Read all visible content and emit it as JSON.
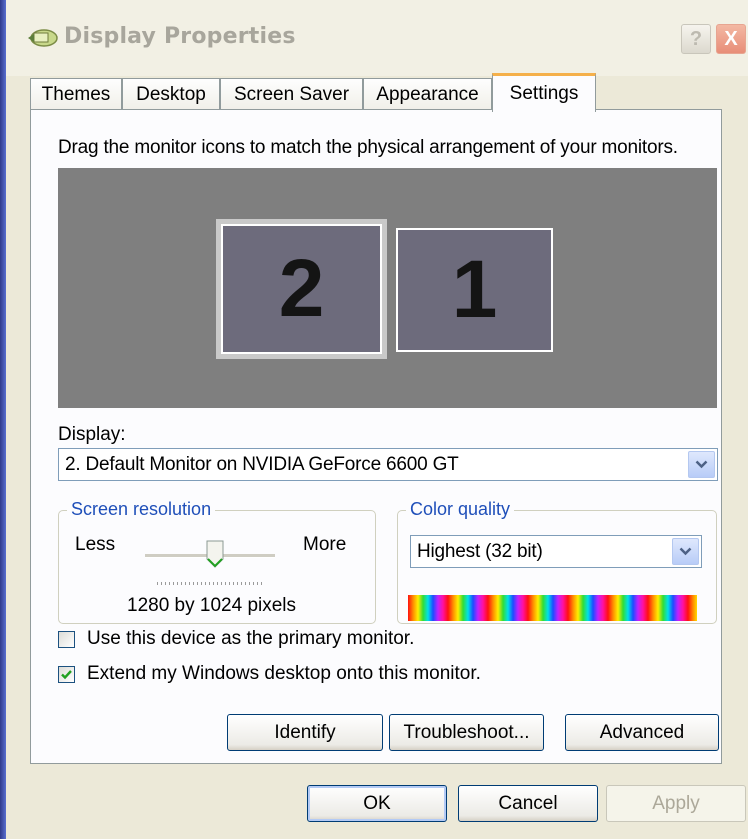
{
  "window": {
    "title": "Display Properties"
  },
  "title_buttons": {
    "help": "?",
    "close": "X"
  },
  "tabs": [
    {
      "label": "Themes"
    },
    {
      "label": "Desktop"
    },
    {
      "label": "Screen Saver"
    },
    {
      "label": "Appearance"
    },
    {
      "label": "Settings",
      "active": true
    }
  ],
  "settings": {
    "instruction": "Drag the monitor icons to match the physical arrangement of your monitors.",
    "monitors": [
      {
        "number": "2",
        "selected": true
      },
      {
        "number": "1",
        "selected": false
      }
    ],
    "display_label": "Display:",
    "display_value": "2. Default Monitor on NVIDIA GeForce 6600 GT",
    "resolution": {
      "title": "Screen resolution",
      "less": "Less",
      "more": "More",
      "value_text": "1280 by 1024 pixels"
    },
    "color_quality": {
      "title": "Color quality",
      "value": "Highest (32 bit)"
    },
    "primary_checkbox": {
      "label": "Use this device as the primary monitor.",
      "checked": false
    },
    "extend_checkbox": {
      "label": "Extend my Windows desktop onto this monitor.",
      "checked": true
    },
    "buttons": {
      "identify": "Identify",
      "troubleshoot": "Troubleshoot...",
      "advanced": "Advanced"
    }
  },
  "dialog_buttons": {
    "ok": "OK",
    "cancel": "Cancel",
    "apply": "Apply"
  },
  "icons": {
    "window_icon": "display-properties-icon",
    "dropdown": "chevron-down-icon",
    "check": "checkmark-icon"
  }
}
